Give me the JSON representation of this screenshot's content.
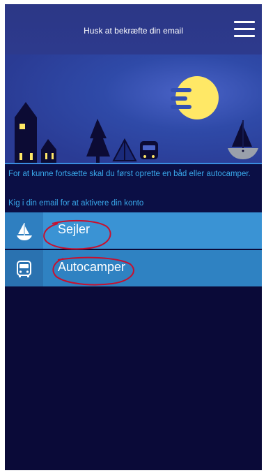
{
  "header": {
    "title": "Husk at bekræfte din email",
    "menu_icon": "hamburger-menu-icon"
  },
  "scene": {
    "description_icons": [
      "house-icon",
      "tree-icon",
      "tent-icon",
      "camper-icon",
      "sailboat-icon",
      "moon-icon"
    ]
  },
  "info": {
    "line1": "For at kunne fortsætte skal du først oprette en båd eller autocamper.",
    "line2": "Kig i din email for at aktivere din konto"
  },
  "options": [
    {
      "label": "Sejler",
      "icon": "sailboat-icon"
    },
    {
      "label": "Autocamper",
      "icon": "camper-icon"
    }
  ],
  "colors": {
    "header": "#2c3786",
    "background": "#0a0a38",
    "info_text": "#39a7ea",
    "option_1": "#3a93d4",
    "option_2": "#2f82c2",
    "annotation": "#c8102e"
  }
}
